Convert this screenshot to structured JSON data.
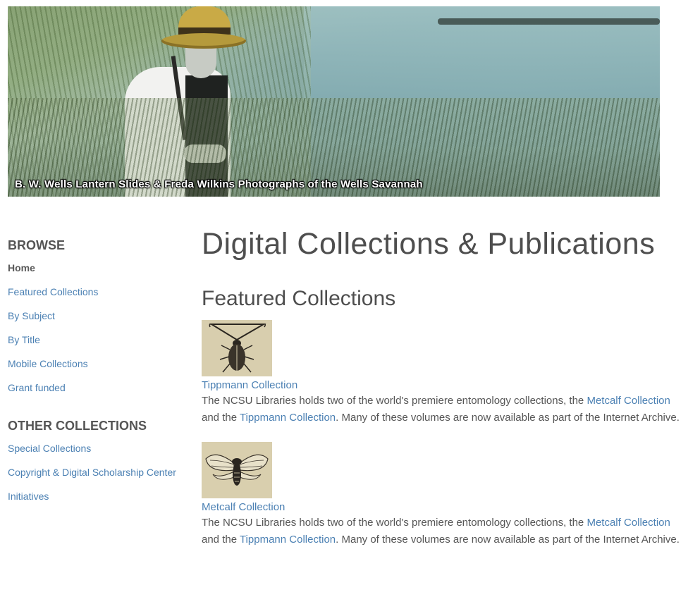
{
  "banner": {
    "caption": "B. W. Wells Lantern Slides & Freda Wilkins Photographs of the Wells Savannah"
  },
  "sidebar": {
    "browse_heading": "BROWSE",
    "browse_items": [
      {
        "label": "Home",
        "current": true
      },
      {
        "label": "Featured Collections",
        "current": false
      },
      {
        "label": "By Subject",
        "current": false
      },
      {
        "label": "By Title",
        "current": false
      },
      {
        "label": "Mobile Collections",
        "current": false
      },
      {
        "label": "Grant funded",
        "current": false
      }
    ],
    "other_heading": "OTHER COLLECTIONS",
    "other_items": [
      {
        "label": "Special Collections"
      },
      {
        "label": "Copyright & Digital Scholarship Center"
      },
      {
        "label": "Initiatives"
      }
    ]
  },
  "main": {
    "page_title": "Digital Collections & Publications",
    "section_title": "Featured Collections",
    "collections": [
      {
        "title": "Tippmann Collection",
        "thumb_icon": "beetle-illustration",
        "desc_before": "The NCSU Libraries holds two of the world's premiere entomology collections, the ",
        "link1": "Metcalf Collection",
        "desc_middle": " and the ",
        "link2": "Tippmann Collection",
        "desc_after": ". Many of these volumes are now available as part of the Internet Archive."
      },
      {
        "title": "Metcalf Collection",
        "thumb_icon": "cicada-illustration",
        "desc_before": "The NCSU Libraries holds two of the world's premiere entomology collections, the ",
        "link1": "Metcalf Collection",
        "desc_middle": " and the ",
        "link2": "Tippmann Collection",
        "desc_after": ". Many of these volumes are now available as part of the Internet Archive."
      }
    ]
  },
  "colors": {
    "link": "#4b80b3",
    "heading": "#4e4e4e",
    "thumb_background": "#d9cfae"
  }
}
